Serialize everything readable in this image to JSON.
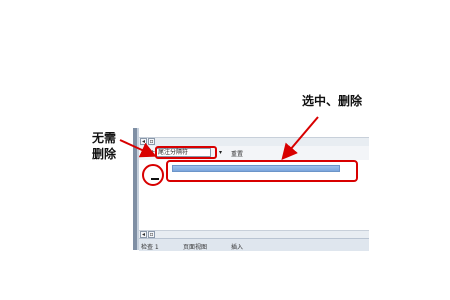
{
  "annotations": {
    "select_delete": "选中、删除",
    "no_need_line1": "无需",
    "no_need_line2": "删除"
  },
  "toolbar": {
    "label": "尾注",
    "select_value": "尾注分隔符",
    "dropdown_arrow": "▾",
    "reset_label": "重置"
  },
  "scroll": {
    "left_arrow": "◂",
    "box": "▫"
  },
  "statusbar": {
    "items": [
      "检查 1",
      "页面视图",
      "插入"
    ]
  },
  "colors": {
    "annotation_red": "#d80000",
    "separator_blue": "#8fb4e4"
  }
}
